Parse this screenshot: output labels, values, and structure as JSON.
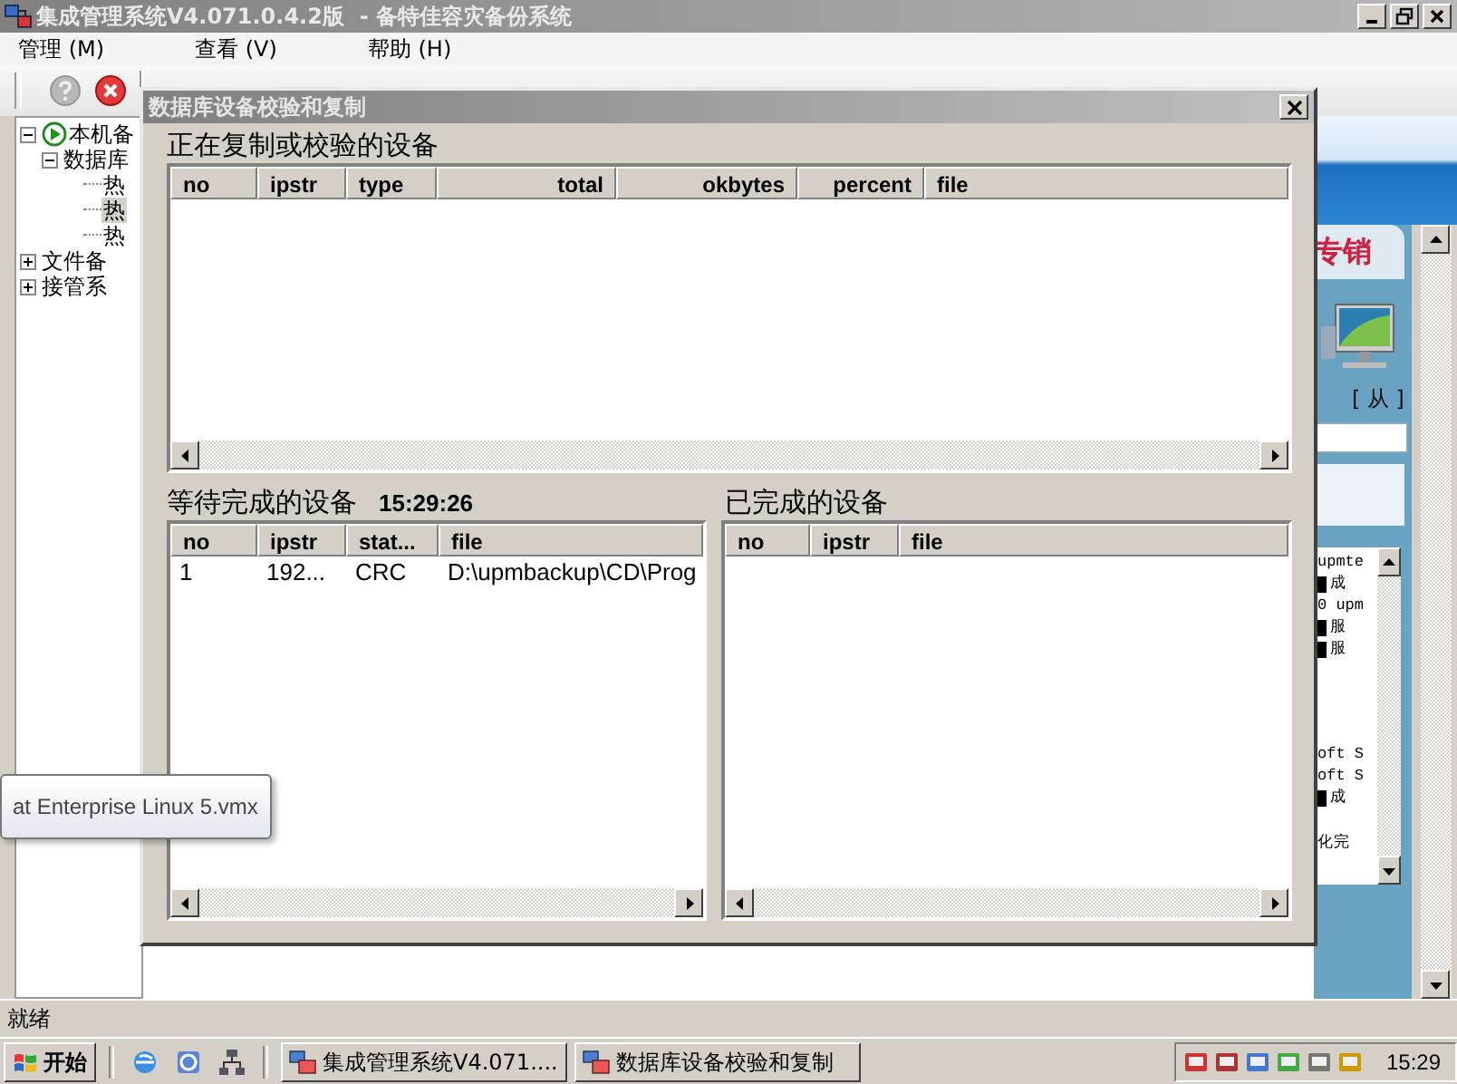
{
  "window": {
    "title": "集成管理系统V4.071.0.4.2版  - 备特佳容灾备份系统"
  },
  "menu": [
    {
      "label": "管理 (M)"
    },
    {
      "label": "查看 (V)"
    },
    {
      "label": "帮助 (H)"
    }
  ],
  "tree": [
    {
      "label": "本机备",
      "expanded": true,
      "selected": false,
      "children": [
        {
          "label": "数据库",
          "expanded": true,
          "selected": false,
          "children": [
            {
              "label": "热",
              "selected": false
            },
            {
              "label": "热",
              "selected": true
            },
            {
              "label": "热",
              "selected": false
            }
          ]
        }
      ]
    },
    {
      "label": "文件备",
      "expanded": false,
      "selected": false
    },
    {
      "label": "接管系",
      "expanded": false,
      "selected": false
    }
  ],
  "side_panel": {
    "banner": "专销",
    "caption": "[ 从 ]",
    "log_groups": [
      [
        {
          "text": "upmte",
          "marked": false
        },
        {
          "text": "成",
          "marked": true
        },
        {
          "text": "0 upm",
          "marked": false
        },
        {
          "text": "服",
          "marked": true
        },
        {
          "text": "服",
          "marked": true
        }
      ],
      [
        {
          "text": "oft S",
          "marked": false
        },
        {
          "text": "oft S",
          "marked": false
        },
        {
          "text": "成",
          "marked": true
        }
      ],
      [
        {
          "text": "化完",
          "marked": false
        }
      ]
    ]
  },
  "dialog": {
    "title": "数据库设备校验和复制",
    "active": {
      "heading": "正在复制或校验的设备",
      "columns": [
        {
          "label": "no"
        },
        {
          "label": "ipstr"
        },
        {
          "label": "type"
        },
        {
          "label": "total"
        },
        {
          "label": "okbytes"
        },
        {
          "label": "percent"
        },
        {
          "label": "file"
        }
      ]
    },
    "pending": {
      "heading": "等待完成的设备",
      "time": "15:29:26",
      "columns": [
        {
          "label": "no"
        },
        {
          "label": "ipstr"
        },
        {
          "label": "stat..."
        },
        {
          "label": "file"
        }
      ],
      "rows": [
        [
          "1",
          "192...",
          "CRC",
          "D:\\upmbackup\\CD\\Prog"
        ]
      ]
    },
    "done": {
      "heading": "已完成的设备",
      "columns": [
        {
          "label": "no"
        },
        {
          "label": "ipstr"
        },
        {
          "label": "file"
        }
      ]
    }
  },
  "tooltip": {
    "text": "at Enterprise Linux 5.vmx"
  },
  "status_bar": {
    "text": "就绪"
  },
  "taskbar": {
    "start": "开始",
    "tasks": [
      {
        "label": "集成管理系统V4.071....",
        "selected": false
      },
      {
        "label": "数据库设备校验和复制",
        "selected": false
      }
    ],
    "clock": "15:29"
  }
}
